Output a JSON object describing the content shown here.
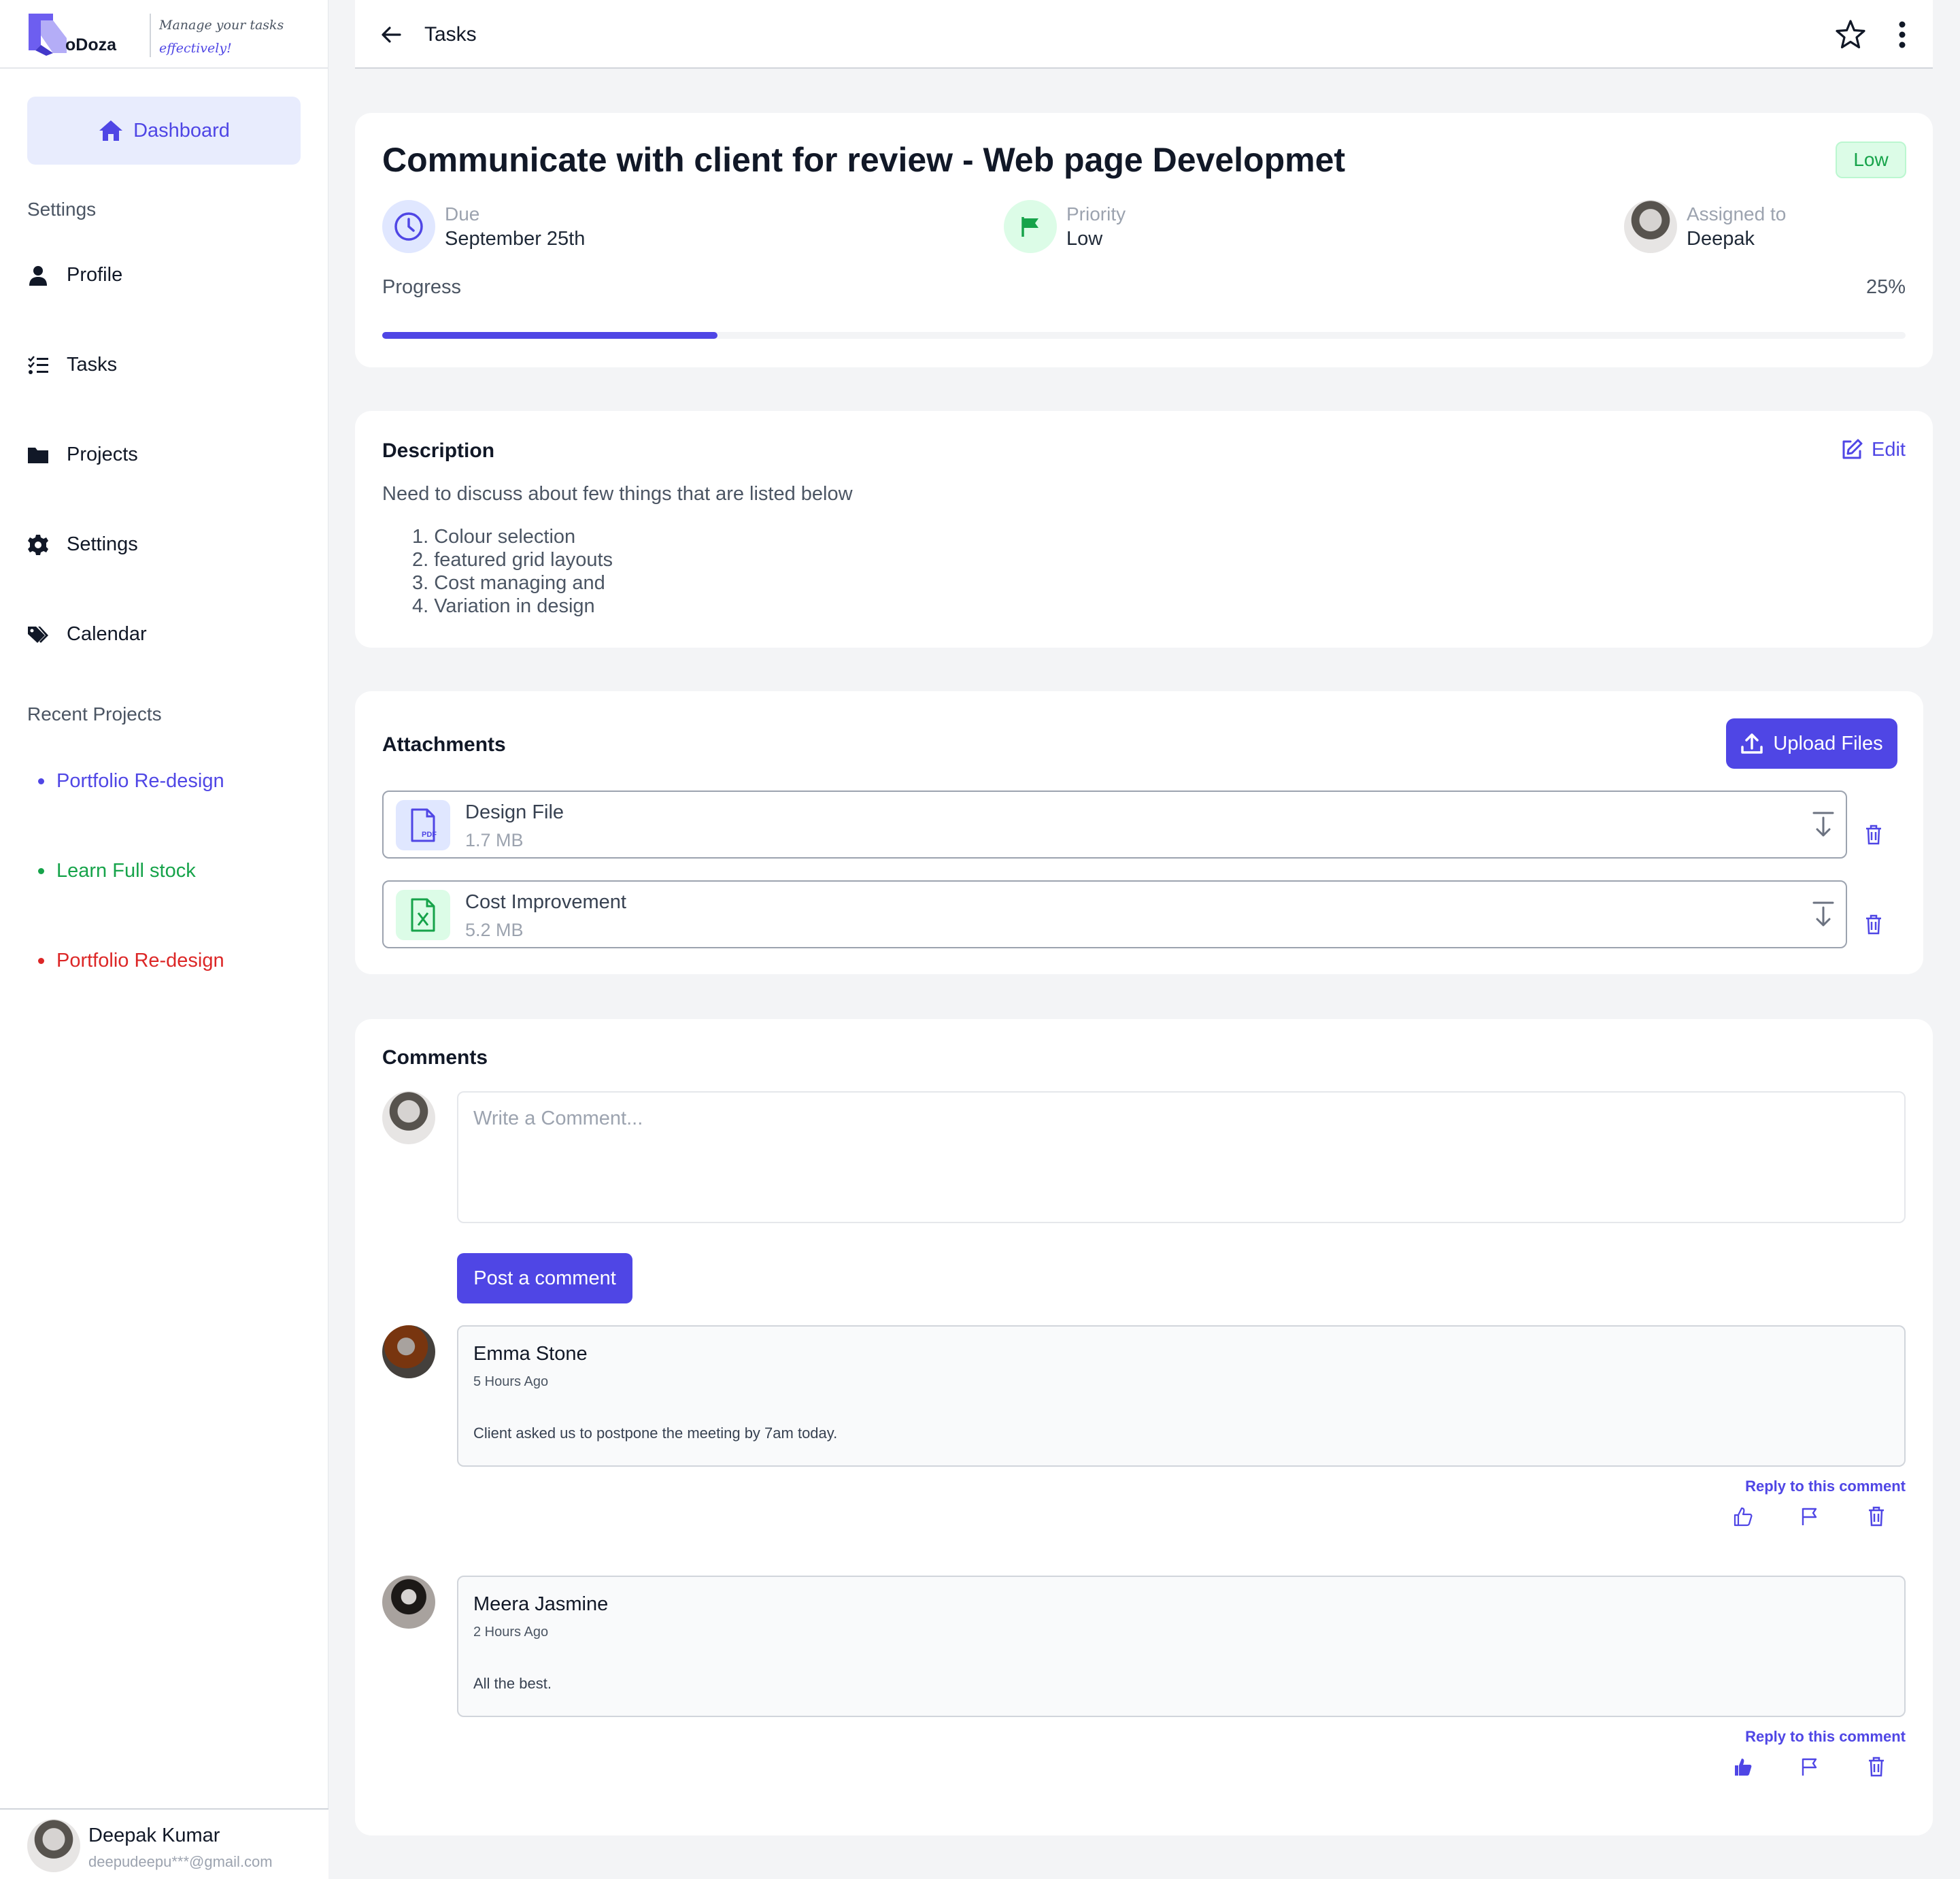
{
  "app": {
    "logo_text": "oDoza",
    "tagline_line1": "Manage your tasks",
    "tagline_line2": "effectively!"
  },
  "sidebar": {
    "dashboard_label": "Dashboard",
    "settings_heading": "Settings",
    "items": [
      {
        "label": "Profile",
        "icon": "user-icon"
      },
      {
        "label": "Tasks",
        "icon": "list-check-icon"
      },
      {
        "label": "Projects",
        "icon": "folder-icon"
      },
      {
        "label": "Settings",
        "icon": "gear-icon"
      },
      {
        "label": "Calendar",
        "icon": "tags-icon"
      }
    ],
    "recent_heading": "Recent Projects",
    "recent_projects": [
      {
        "label": "Portfolio Re-design",
        "color": "#4f46e5"
      },
      {
        "label": "Learn Full stock",
        "color": "#16a34a"
      },
      {
        "label": "Portfolio Re-design",
        "color": "#dc2626"
      }
    ],
    "user": {
      "name": "Deepak Kumar",
      "email": "deepudeepu***@gmail.com"
    }
  },
  "topbar": {
    "title": "Tasks"
  },
  "task": {
    "title": "Communicate with client for review - Web page Developmet",
    "badge": "Low",
    "due_label": "Due",
    "due_value": "September 25th",
    "priority_label": "Priority",
    "priority_value": "Low",
    "assigned_label": "Assigned to",
    "assigned_value": "Deepak",
    "progress_label": "Progress",
    "progress_text": "25%",
    "progress_value": 0.22
  },
  "description": {
    "heading": "Description",
    "edit_label": "Edit",
    "intro": "Need to discuss about few things that are listed below",
    "items": [
      "1. Colour selection",
      "2. featured grid layouts",
      "3. Cost managing and",
      "4. Variation in design"
    ]
  },
  "attachments": {
    "heading": "Attachments",
    "upload_label": "Upload Files",
    "files": [
      {
        "name": "Design File",
        "size": "1.7 MB",
        "icon": "pdf-file-icon"
      },
      {
        "name": "Cost Improvement",
        "size": "5.2 MB",
        "icon": "excel-file-icon"
      }
    ]
  },
  "comments": {
    "heading": "Comments",
    "placeholder": "Write a Comment...",
    "post_label": "Post a comment",
    "reply_label": "Reply to this comment",
    "items": [
      {
        "name": "Emma Stone",
        "time": "5 Hours Ago",
        "text": "Client asked us to postpone the meeting by 7am today.",
        "liked": false
      },
      {
        "name": "Meera Jasmine",
        "time": "2 Hours Ago",
        "text": "All the best.",
        "liked": true
      }
    ]
  },
  "colors": {
    "accent": "#4f46e5",
    "success": "#16a34a",
    "danger": "#dc2626"
  }
}
